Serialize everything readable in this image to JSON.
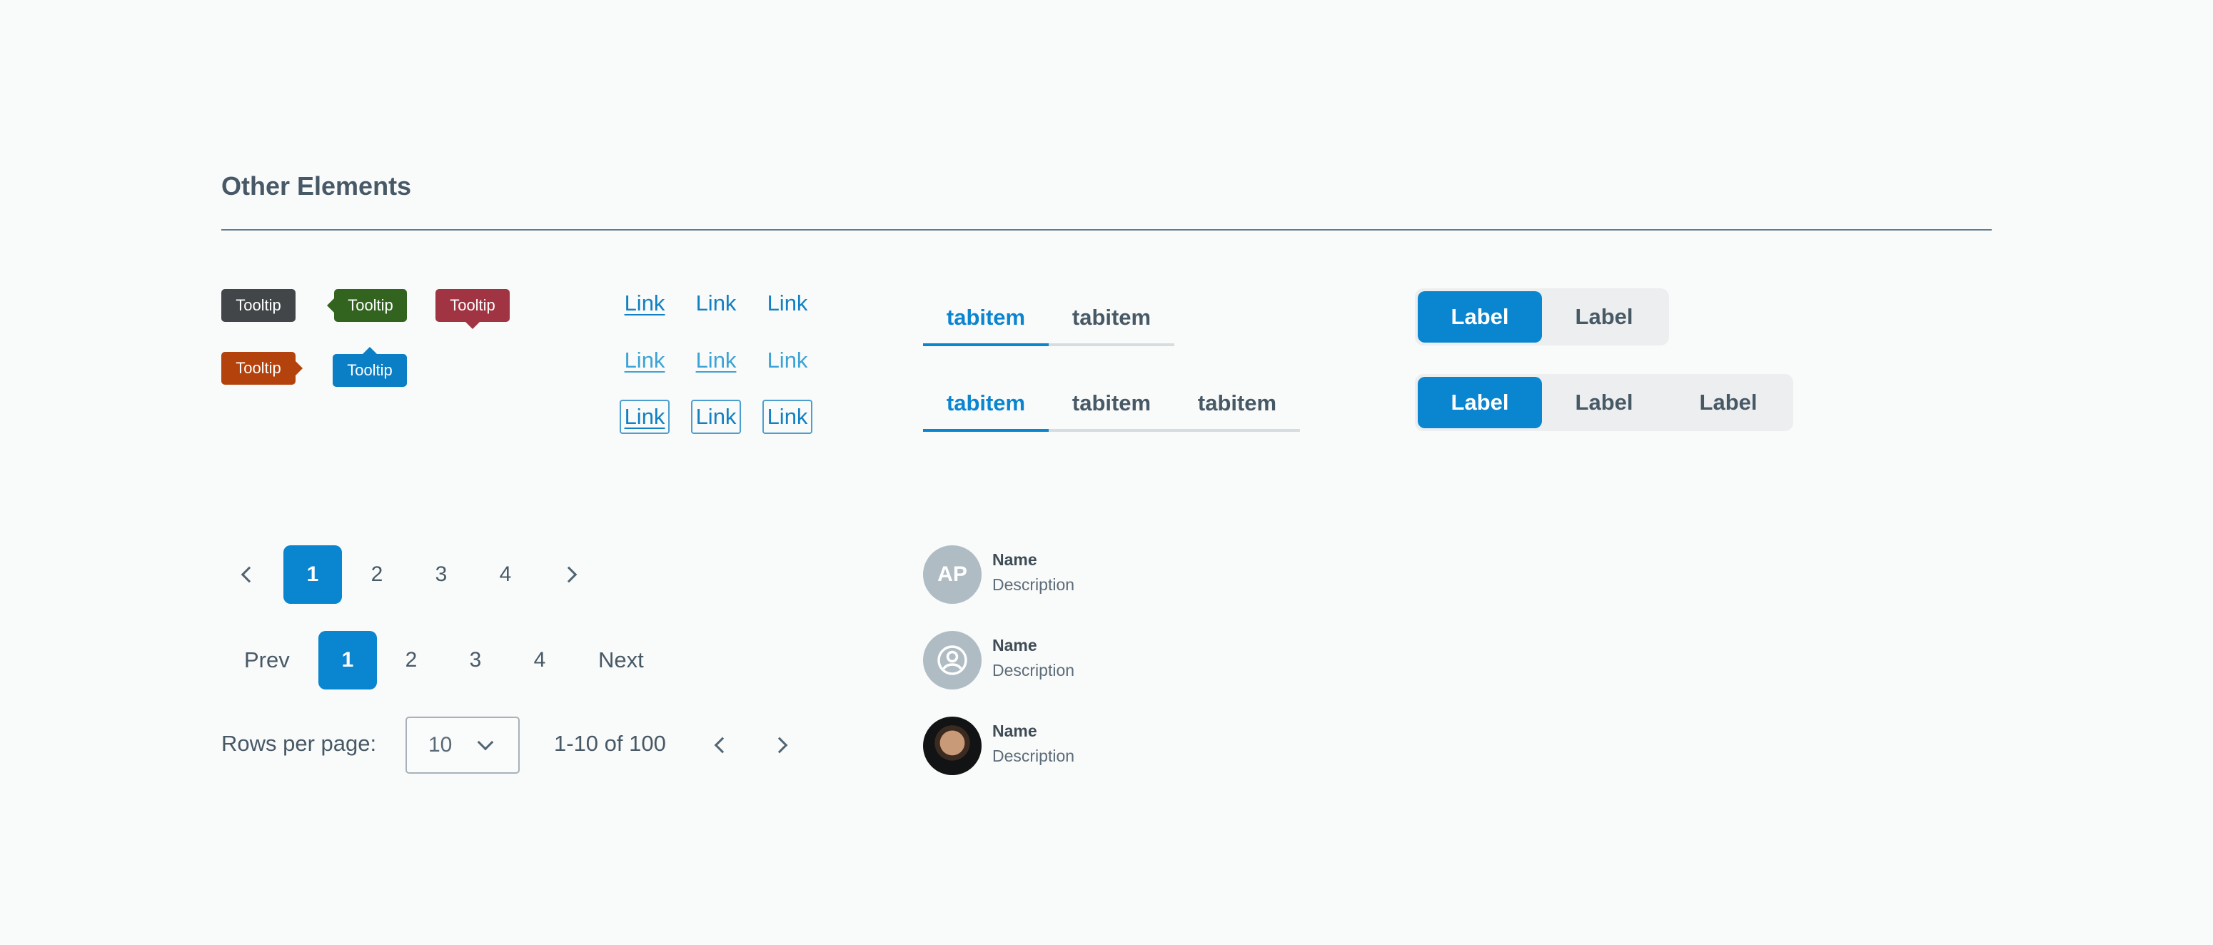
{
  "section": {
    "title": "Other Elements"
  },
  "tooltips": {
    "dark": "Tooltip",
    "green": "Tooltip",
    "red": "Tooltip",
    "orange": "Tooltip",
    "blue": "Tooltip"
  },
  "links": {
    "row1": [
      "Link",
      "Link",
      "Link"
    ],
    "row2": [
      "Link",
      "Link",
      "Link"
    ],
    "row3": [
      "Link",
      "Link",
      "Link"
    ]
  },
  "tabs": {
    "two": [
      "tabitem",
      "tabitem"
    ],
    "three": [
      "tabitem",
      "tabitem",
      "tabitem"
    ]
  },
  "segmented": {
    "two": [
      "Label",
      "Label"
    ],
    "three": [
      "Label",
      "Label",
      "Label"
    ]
  },
  "pagination": {
    "pages": [
      "1",
      "2",
      "3",
      "4"
    ],
    "prev_label": "Prev",
    "next_label": "Next",
    "rows_per_page_label": "Rows per page:",
    "rows_per_page_value": "10",
    "range_text": "1-10 of 100"
  },
  "people": [
    {
      "initials": "AP",
      "name": "Name",
      "description": "Description"
    },
    {
      "name": "Name",
      "description": "Description"
    },
    {
      "name": "Name",
      "description": "Description"
    }
  ],
  "colors": {
    "accent": "#0a85cf",
    "tooltip_dark": "#424649",
    "tooltip_green": "#32641f",
    "tooltip_red": "#a03442",
    "tooltip_orange": "#b4420c",
    "tooltip_blue": "#0b7fc6"
  }
}
